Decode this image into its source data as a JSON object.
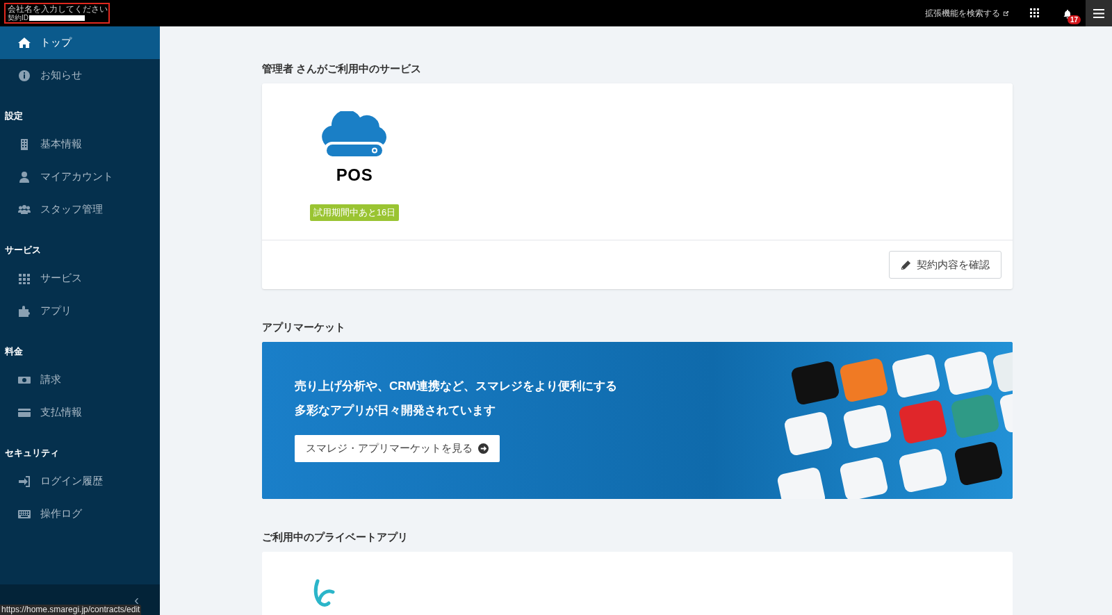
{
  "header": {
    "company_placeholder": "会社名を入力してください",
    "contract_id_label": "契約ID",
    "extension_search": "拡張機能を検索する",
    "notification_count": "17"
  },
  "sidebar": {
    "top_items": [
      {
        "label": "トップ",
        "selected": true
      },
      {
        "label": "お知らせ",
        "selected": false
      }
    ],
    "sections": [
      {
        "title": "設定",
        "items": [
          {
            "label": "基本情報",
            "selected": false
          },
          {
            "label": "マイアカウント",
            "selected": false
          },
          {
            "label": "スタッフ管理",
            "selected": false
          }
        ]
      },
      {
        "title": "サービス",
        "items": [
          {
            "label": "サービス",
            "selected": false
          },
          {
            "label": "アプリ",
            "selected": false
          }
        ]
      },
      {
        "title": "料金",
        "items": [
          {
            "label": "請求",
            "selected": false
          },
          {
            "label": "支払情報",
            "selected": false
          }
        ]
      },
      {
        "title": "セキュリティ",
        "items": [
          {
            "label": "ログイン履歴",
            "selected": false
          },
          {
            "label": "操作ログ",
            "selected": false
          }
        ]
      }
    ],
    "collapse_glyph": "‹"
  },
  "services": {
    "heading": "管理者 さんがご利用中のサービス",
    "service_name": "POS",
    "trial_badge": "試用期間中あと16日",
    "confirm_button": "契約内容を確認"
  },
  "app_market": {
    "heading": "アプリマーケット",
    "lines": [
      "売り上げ分析や、CRM連携など、スマレジをより便利にする",
      "多彩なアプリが日々開発されています"
    ],
    "button": "スマレジ・アプリマーケットを見る"
  },
  "private_apps": {
    "heading": "ご利用中のプライベートアプリ"
  },
  "status_url": "https://home.smaregi.jp/contracts/edit"
}
